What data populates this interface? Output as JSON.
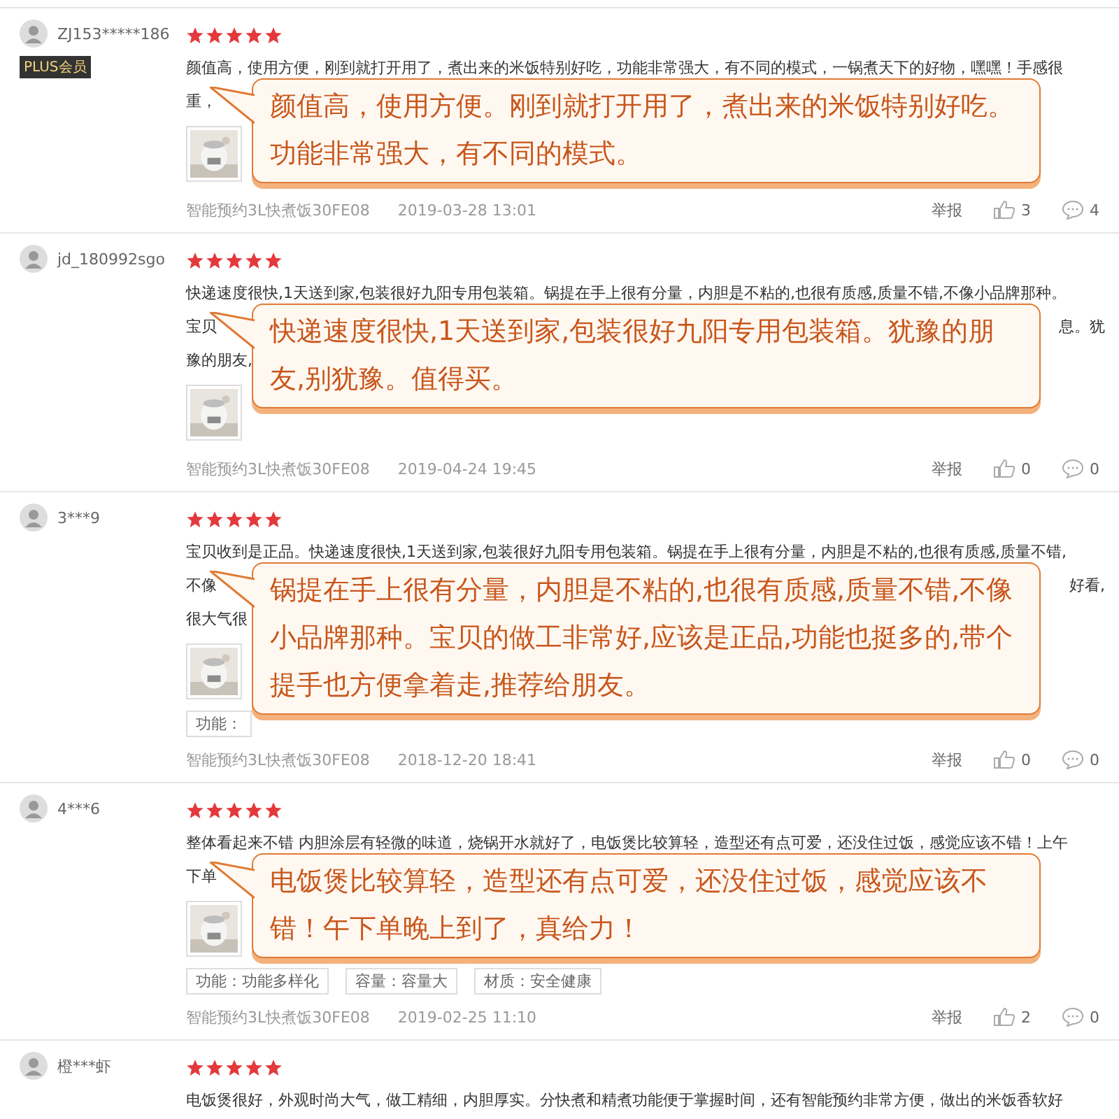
{
  "reviews": [
    {
      "user": "ZJ153*****186",
      "badge": "PLUS会员",
      "stars": 5,
      "lines": [
        {
          "left": "颜值高，使用方便，刚到就打开用了，煮出来的米饭特别好吃，功能非常强大，有不同的模式，一锅煮天下的好物，嘿嘿！手感很"
        },
        {
          "left": "重，"
        }
      ],
      "photos": [
        {
          "kind": "picture"
        }
      ],
      "callout": "颜值高，使用方便。刚到就打开用了，煮出来的米饭特别好吃。功能非常强大，有不同的模式。",
      "product": "智能预约3L快煮饭30FE08",
      "date": "2019-03-28 13:01",
      "report": "举报",
      "likes": "3",
      "comments": "4"
    },
    {
      "user": "jd_180992sgo",
      "stars": 5,
      "lines": [
        {
          "left": "快递速度很快,1天送到家,包装很好九阳专用包装箱。锅提在手上很有分量，内胆是不粘的,也很有质感,质量不错,不像小品牌那种。"
        },
        {
          "left": "宝贝",
          "right": "息。犹"
        },
        {
          "left": "豫的朋友,"
        }
      ],
      "photos": [
        {
          "kind": "picture"
        }
      ],
      "callout": "快递速度很快,1天送到家,包装很好九阳专用包装箱。犹豫的朋友,别犹豫。值得买。",
      "product": "智能预约3L快煮饭30FE08",
      "date": "2019-04-24 19:45",
      "report": "举报",
      "likes": "0",
      "comments": "0"
    },
    {
      "user": "3***9",
      "stars": 5,
      "lines": [
        {
          "left": "宝贝收到是正品。快递速度很快,1天送到家,包装很好九阳专用包装箱。锅提在手上很有分量，内胆是不粘的,也很有质感,质量不错,"
        },
        {
          "left": "不像",
          "right": "好看,"
        },
        {
          "left": "很大气很"
        }
      ],
      "photos": [
        {
          "kind": "picture"
        }
      ],
      "tags": [
        "功能："
      ],
      "callout": "锅提在手上很有分量，内胆是不粘的,也很有质感,质量不错,不像小品牌那种。宝贝的做工非常好,应该是正品,功能也挺多的,带个提手也方便拿着走,推荐给朋友。",
      "product": "智能预约3L快煮饭30FE08",
      "date": "2018-12-20 18:41",
      "report": "举报",
      "likes": "0",
      "comments": "0"
    },
    {
      "user": "4***6",
      "stars": 5,
      "lines": [
        {
          "left": "整体看起来不错 内胆涂层有轻微的味道，烧锅开水就好了，电饭煲比较算轻，造型还有点可爱，还没住过饭，感觉应该不错！上午"
        },
        {
          "left": "下单"
        }
      ],
      "photos": [
        {
          "kind": "picture"
        }
      ],
      "tags": [
        "功能：功能多样化",
        "容量：容量大",
        "材质：安全健康"
      ],
      "callout": "电饭煲比较算轻，造型还有点可爱，还没住过饭，感觉应该不错！午下单晚上到了，真给力！",
      "product": "智能预约3L快煮饭30FE08",
      "date": "2019-02-25 11:10",
      "report": "举报",
      "likes": "2",
      "comments": "0"
    },
    {
      "user": "橙***虾",
      "stars": 5,
      "lines": [
        {
          "left": "电饭煲很好，外观时尚大气，做工精细，内胆厚实。分快煮和精煮功能便于掌握时间，还有智能预约非常方便，做出的米饭香软好"
        }
      ]
    }
  ]
}
